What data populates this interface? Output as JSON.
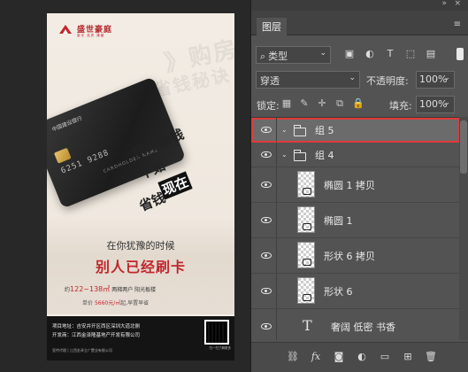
{
  "poster": {
    "logo_name": "盛世豪庭",
    "logo_sub": "豪宅 品质 臻藏",
    "watermark_1": "》购房",
    "watermark_2": "省钱秘诀",
    "card_bank": "中国建设银行",
    "card_number": "6251  9288",
    "card_holder": "CARDHOLDER NAME",
    "slogan_1": "拼命赚钱",
    "slogan_2": "不如",
    "slogan_3": "现在",
    "slogan_4": "省钱",
    "line_1": "在你犹豫的时候",
    "line_2": "别人已经刷卡",
    "area_prefix": "约",
    "area_value": "122~138㎡",
    "area_suffix": "两梯两户 阳光板楼",
    "price_prefix": "单价",
    "price_value": "5660元/㎡",
    "price_suffix": "起,早置早省",
    "footer_1": "项目地址：吉安井开区西区深圳大道北侧",
    "footer_2": "开发商：江西金泽隆基地产开发有限公司",
    "footer_3": "宣传代理 | 江西金泽立广置业有限公司",
    "qr_caption": "扫一扫了解更多"
  },
  "panel": {
    "tab_title": "图层",
    "kind_label": "类型",
    "blend_mode": "穿透",
    "opacity_label": "不透明度:",
    "opacity_value": "100%",
    "lock_label": "锁定:",
    "fill_label": "填充:",
    "fill_value": "100%",
    "layers": [
      {
        "name": "组 5",
        "type": "group",
        "selected": true,
        "expanded": true,
        "indent": 0
      },
      {
        "name": "组 4",
        "type": "group",
        "selected": false,
        "expanded": true,
        "indent": 1
      },
      {
        "name": "椭圆 1 拷贝",
        "type": "shape",
        "selected": false,
        "indent": 2
      },
      {
        "name": "椭圆 1",
        "type": "shape",
        "selected": false,
        "indent": 2
      },
      {
        "name": "形状 6 拷贝",
        "type": "shape",
        "selected": false,
        "indent": 2
      },
      {
        "name": "形状 6",
        "type": "shape",
        "selected": false,
        "indent": 2
      },
      {
        "name": "奢阔  低密  书香",
        "type": "text",
        "selected": false,
        "indent": 2
      }
    ]
  }
}
